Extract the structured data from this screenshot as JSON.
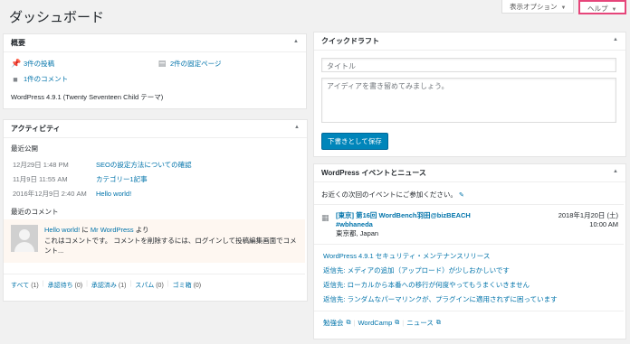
{
  "page_title": "ダッシュボード",
  "screen_options": {
    "display_options": "表示オプション",
    "help": "ヘルプ"
  },
  "at_a_glance": {
    "title": "概要",
    "posts": "3件の投稿",
    "pages": "2件の固定ページ",
    "comments": "1件のコメント",
    "version": "WordPress 4.9.1 (Twenty Seventeen Child テーマ)"
  },
  "activity": {
    "title": "アクティビティ",
    "recent_published_label": "最近公開",
    "posts": [
      {
        "date": "12月29日 1:48 PM",
        "title": "SEOの設定方法についての確認"
      },
      {
        "date": "11月9日 11:55 AM",
        "title": "カテゴリー1記事"
      },
      {
        "date": "2016年12月9日 2:40 AM",
        "title": "Hello world!"
      }
    ],
    "recent_comments_label": "最近のコメント",
    "comment": {
      "post": "Hello world!",
      "on": "に",
      "author": "Mr WordPress",
      "from": "より",
      "text": "これはコメントです。 コメントを削除するには、ログインして投稿編集画面でコメント..."
    },
    "filters": [
      {
        "label": "すべて",
        "count": "(1)"
      },
      {
        "label": "承認待ち",
        "count": "(0)"
      },
      {
        "label": "承認済み",
        "count": "(1)"
      },
      {
        "label": "スパム",
        "count": "(0)"
      },
      {
        "label": "ゴミ箱",
        "count": "(0)"
      }
    ]
  },
  "quick_draft": {
    "title": "クイックドラフト",
    "title_placeholder": "タイトル",
    "content_placeholder": "アイディアを書き留めてみましょう。",
    "save_button": "下書きとして保存"
  },
  "events": {
    "title": "WordPress イベントとニュース",
    "intro": "お近くの次回のイベントにご参加ください。",
    "event": {
      "name_line1": "[東京] 第16回 WordBench羽田@bizBEACH",
      "name_line2": "#wbhaneda",
      "location": "東京都, Japan",
      "date": "2018年1月20日 (土)",
      "time": "10:00 AM"
    },
    "news": [
      "WordPress 4.9.1 セキュリティ・メンテナンスリリース",
      "返信先: メディアの追加（アップロード）が少しおかしいです",
      "返信先: ローカルから本番への移行が何度やってもうまくいきません",
      "返信先: ランダムなパーマリンクが、プラグインに適用されずに困っています"
    ],
    "footer": {
      "meetups": "勉強会",
      "wordcamp": "WordCamp",
      "news": "ニュース"
    }
  },
  "colors": {
    "highlight": "#e6457a",
    "link": "#0073aa",
    "primary_button": "#0085ba"
  }
}
